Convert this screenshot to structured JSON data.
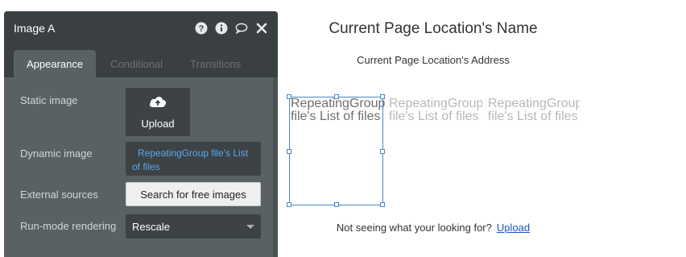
{
  "panel": {
    "title": "Image A",
    "header_icons": [
      "question-icon",
      "info-icon",
      "comment-icon",
      "close-icon"
    ],
    "tabs": [
      {
        "label": "Appearance",
        "active": true
      },
      {
        "label": "Conditional",
        "active": false
      },
      {
        "label": "Transitions",
        "active": false
      }
    ],
    "fields": {
      "static_image": {
        "label": "Static image",
        "upload_label": "Upload",
        "icon": "cloud-upload-icon"
      },
      "dynamic_image": {
        "label": "Dynamic image",
        "value": "RepeatingGroup file's List of files"
      },
      "external_sources": {
        "label": "External sources",
        "button_label": "Search for free images"
      },
      "run_mode": {
        "label": "Run-mode rendering",
        "value": "Rescale"
      }
    }
  },
  "canvas": {
    "page_title": "Current Page Location's Name",
    "page_address": "Current Page Location's Address",
    "repeating_cells": [
      {
        "line1": "RepeatingGroup",
        "line2": "file's List of files"
      },
      {
        "line1": "RepeatingGroup",
        "line2": "file's List of files"
      },
      {
        "line1": "RepeatingGroup",
        "line2": "file's List of files"
      }
    ],
    "footer_text": "Not seeing what your looking for?",
    "footer_link": "Upload"
  },
  "colors": {
    "panel_bg": "#596163",
    "panel_header": "#3a3f41",
    "field_bg": "#3d4345",
    "dynamic_text": "#5aa8ee",
    "selection": "#4a86c8",
    "link": "#1a54c4"
  }
}
